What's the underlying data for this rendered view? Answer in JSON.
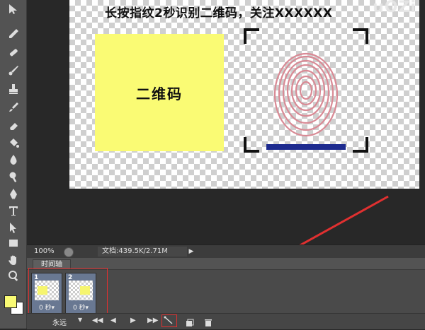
{
  "document": {
    "headline": "长按指纹2秒识别二维码，关注XXXXXX",
    "watermark": "uOZi",
    "qr_label": "二维码"
  },
  "status_bar": {
    "zoom": "100%",
    "doc_info": "文档:439.5K/2.71M"
  },
  "timeline": {
    "tab_label": "时间轴",
    "frames": [
      {
        "number": "1",
        "delay": "0 秒▾"
      },
      {
        "number": "2",
        "delay": "0 秒▾"
      }
    ],
    "loop_label": "永远",
    "controls": {
      "first": "◀◀",
      "prev": "◀",
      "play": "▶",
      "next": "▶▶"
    }
  },
  "colors": {
    "foreground": "#fafb74",
    "background": "#ffffff",
    "highlight": "#e03030",
    "frame_bg": "#697892"
  }
}
